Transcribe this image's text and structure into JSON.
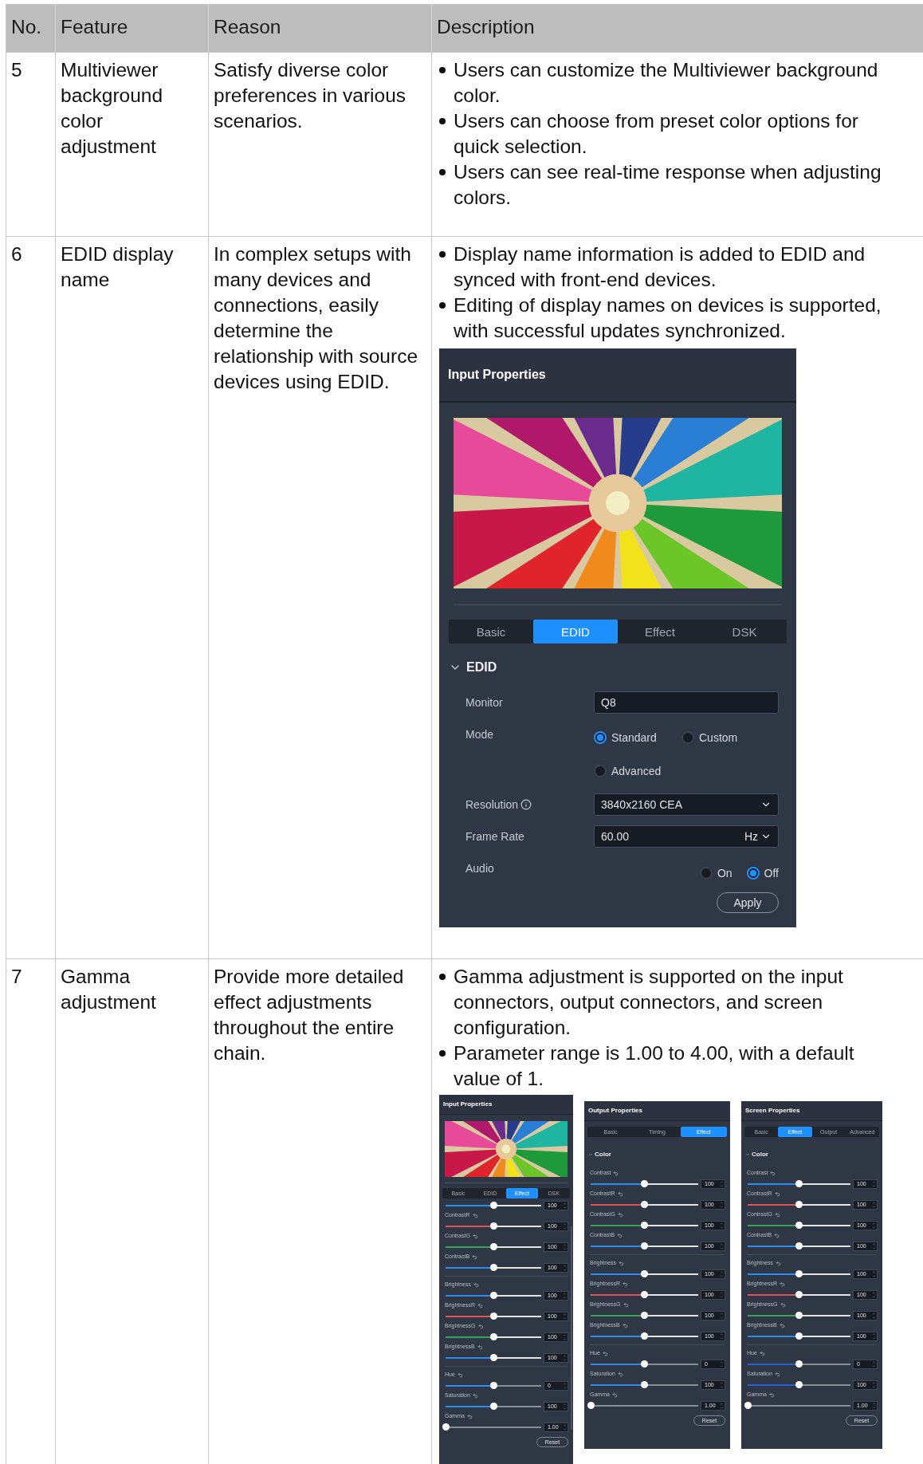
{
  "table": {
    "columns": [
      "No.",
      "Feature",
      "Reason",
      "Description"
    ],
    "rows": [
      {
        "no": "5",
        "feature": "Multiviewer background color adjustment",
        "reason": "Satisfy diverse color preferences in various scenarios.",
        "description": [
          "Users can customize the Multiviewer background color.",
          "Users can choose from preset color options for quick selection.",
          "Users can see real-time response when adjusting colors."
        ]
      },
      {
        "no": "6",
        "feature": "EDID display name",
        "reason": "In complex setups with many devices and connections, easily determine the relationship with source devices using EDID.",
        "description": [
          "Display name information is added to EDID and synced with front-end devices.",
          "Editing of display names on devices is supported, with successful updates synchronized."
        ],
        "panels": [
          {
            "kind": "edid",
            "title": "Input Properties",
            "preview": {
              "kind": "picture"
            },
            "tabs": [
              {
                "label": "Basic",
                "selected": false
              },
              {
                "label": "EDID",
                "selected": true
              },
              {
                "label": "Effect",
                "selected": false
              },
              {
                "label": "DSK",
                "selected": false
              }
            ],
            "section": {
              "label": "EDID",
              "expanded": true
            },
            "fields": [
              {
                "kind": "text",
                "label": "Monitor",
                "value": "Q8"
              },
              {
                "kind": "radios",
                "label": "Mode",
                "options": [
                  {
                    "label": "Standard",
                    "selected": true
                  },
                  {
                    "label": "Custom",
                    "selected": false
                  },
                  {
                    "label": "Advanced",
                    "selected": false
                  }
                ]
              },
              {
                "kind": "select",
                "label": "Resolution",
                "info": true,
                "value": "3840x2160 CEA"
              },
              {
                "kind": "select",
                "label": "Frame Rate",
                "value": "60.00",
                "unit": "Hz"
              },
              {
                "kind": "toggle",
                "label": "Audio",
                "options": [
                  {
                    "label": "On",
                    "selected": false
                  },
                  {
                    "label": "Off",
                    "selected": true
                  }
                ]
              }
            ],
            "button": "Apply"
          }
        ]
      },
      {
        "no": "7",
        "feature": "Gamma adjustment",
        "reason": "Provide more detailed effect adjustments throughout the entire chain.",
        "description": [
          "Gamma adjustment is supported on the input connectors, output connectors, and screen configuration.",
          "Parameter range is 1.00 to 4.00, with a default value of 1."
        ],
        "panels": [
          {
            "kind": "effect",
            "title": "Input Properties",
            "preview": {
              "kind": "picture"
            },
            "tabs": [
              {
                "label": "Basic",
                "selected": false
              },
              {
                "label": "EDID",
                "selected": false
              },
              {
                "label": "Effect",
                "selected": true
              },
              {
                "label": "DSK",
                "selected": false
              }
            ],
            "groups": [
              [
                {
                  "color": "#2d8cf0",
                  "level": 0.5,
                  "value": "100"
                },
                {
                  "label": "ContrastR",
                  "color": "#e05555",
                  "level": 0.5,
                  "value": "100"
                },
                {
                  "label": "ContrastG",
                  "color": "#3aa35a",
                  "level": 0.5,
                  "value": "100"
                },
                {
                  "label": "ContrastB",
                  "color": "#2d8cf0",
                  "level": 0.5,
                  "value": "100"
                }
              ],
              [
                {
                  "label": "Brightness",
                  "color": "#2d8cf0",
                  "level": 0.5,
                  "value": "100"
                },
                {
                  "label": "BrightnessR",
                  "color": "#e05555",
                  "level": 0.5,
                  "value": "100"
                },
                {
                  "label": "BrightnessG",
                  "color": "#3aa35a",
                  "level": 0.5,
                  "value": "100"
                },
                {
                  "label": "BrightnessB",
                  "color": "#2d8cf0",
                  "level": 0.5,
                  "value": "100"
                }
              ],
              [
                {
                  "label": "Hue",
                  "color": "#2d8cf0",
                  "level": 0.5,
                  "value": "0"
                },
                {
                  "label": "Saturation",
                  "color": "#2d8cf0",
                  "level": 0.5,
                  "value": "100"
                },
                {
                  "label": "Gamma",
                  "level": 0,
                  "value": "1.00"
                }
              ]
            ],
            "button": "Reset"
          },
          {
            "kind": "effect",
            "title": "Output Properties",
            "tabs": [
              {
                "label": "Basic",
                "selected": false
              },
              {
                "label": "Timing",
                "selected": false
              },
              {
                "label": "Effect",
                "selected": true
              }
            ],
            "section": {
              "label": "Color",
              "expanded": true
            },
            "groups": [
              [
                {
                  "label": "Contrast",
                  "color": "#2d8cf0",
                  "level": 0.5,
                  "value": "100"
                },
                {
                  "label": "ContrastR",
                  "color": "#e05555",
                  "level": 0.5,
                  "value": "100"
                },
                {
                  "label": "ContrastG",
                  "color": "#3aa35a",
                  "level": 0.5,
                  "value": "100"
                },
                {
                  "label": "ContrastB",
                  "color": "#2d8cf0",
                  "level": 0.5,
                  "value": "100"
                }
              ],
              [
                {
                  "label": "Brightness",
                  "color": "#2d8cf0",
                  "level": 0.5,
                  "value": "100"
                },
                {
                  "label": "BrightnessR",
                  "color": "#e05555",
                  "level": 0.5,
                  "value": "100"
                },
                {
                  "label": "BrightnessG",
                  "color": "#3aa35a",
                  "level": 0.5,
                  "value": "100"
                },
                {
                  "label": "BrightnessB",
                  "color": "#2d8cf0",
                  "level": 0.5,
                  "value": "100"
                }
              ],
              [
                {
                  "label": "Hue",
                  "color": "#2d8cf0",
                  "level": 0.5,
                  "value": "0"
                },
                {
                  "label": "Saturation",
                  "color": "#2d8cf0",
                  "level": 0.5,
                  "value": "100"
                },
                {
                  "label": "Gamma",
                  "level": 0,
                  "value": "1.00"
                }
              ]
            ],
            "button": "Reset"
          },
          {
            "kind": "effect",
            "title": "Screen Properties",
            "tabs": [
              {
                "label": "Basic",
                "selected": false
              },
              {
                "label": "Effect",
                "selected": true
              },
              {
                "label": "Output",
                "selected": false
              },
              {
                "label": "Advanced",
                "selected": false
              }
            ],
            "section": {
              "label": "Color",
              "expanded": true
            },
            "groups": [
              [
                {
                  "label": "Contrast",
                  "color": "#2d8cf0",
                  "level": 0.5,
                  "value": "100"
                },
                {
                  "label": "ContrastR",
                  "color": "#e05555",
                  "level": 0.5,
                  "value": "100"
                },
                {
                  "label": "ContrastG",
                  "color": "#3aa35a",
                  "level": 0.5,
                  "value": "100"
                },
                {
                  "label": "ContrastB",
                  "color": "#2d8cf0",
                  "level": 0.5,
                  "value": "100"
                }
              ],
              [
                {
                  "label": "Brightness",
                  "color": "#2d8cf0",
                  "level": 0.5,
                  "value": "100"
                },
                {
                  "label": "BrightnessR",
                  "color": "#e05555",
                  "level": 0.5,
                  "value": "100"
                },
                {
                  "label": "BrightnessG",
                  "color": "#3aa35a",
                  "level": 0.5,
                  "value": "100"
                },
                {
                  "label": "BrightnessB",
                  "color": "#2d8cf0",
                  "level": 0.5,
                  "value": "100"
                }
              ],
              [
                {
                  "label": "Hue",
                  "color": "#2b5fd9",
                  "level": 0.5,
                  "value": "0"
                },
                {
                  "label": "Saturation",
                  "color": "#2b5fd9",
                  "level": 0.5,
                  "value": "100"
                },
                {
                  "label": "Gamma",
                  "level": 0,
                  "value": "1.00"
                }
              ]
            ],
            "button": "Reset"
          }
        ]
      }
    ]
  }
}
